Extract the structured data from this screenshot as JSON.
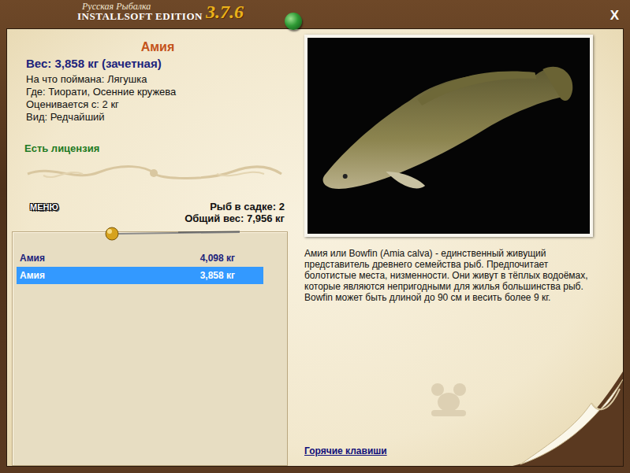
{
  "window": {
    "logo_line1": "Русская Рыбалка",
    "logo_line2": "INSTALLSOFT EDITION",
    "version": "3.7.6",
    "close": "X"
  },
  "fish": {
    "name": "Амия",
    "weight": "Вес: 3,858 кг (зачетная)",
    "details": [
      "На что поймана: Лягушка",
      "Где: Тиорати, Осенние кружева",
      "Оценивается с: 2 кг",
      "Вид: Редчайший"
    ],
    "license": "Есть лицензия"
  },
  "keepnet": {
    "count": "Рыб в садке: 2",
    "total": "Общий вес: 7,956 кг"
  },
  "menu_button": "МЕНЮ",
  "catch_list": [
    {
      "name": "Амия",
      "weight": "4,098 кг",
      "selected": false
    },
    {
      "name": "Амия",
      "weight": "3,858 кг",
      "selected": true
    }
  ],
  "description": "Амия или Bowfin (Amia calva) - единственный живущий представитель древнего семейства рыб. Предпочитает болотистые места, низменности. Они живут в тёплых водоёмах, которые являются непригодными для жилья большинства рыб. Bowfin может быть длиной до 90 см и весить более 9 кг.",
  "hotkeys_link": "Горячие клавиши"
}
